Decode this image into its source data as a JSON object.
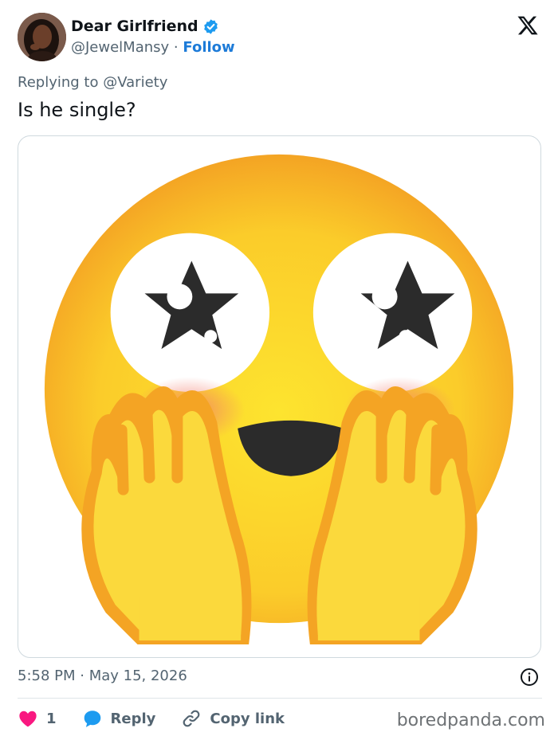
{
  "author": {
    "display_name": "Dear Girlfriend",
    "handle": "@JewelMansy",
    "separator": "·",
    "follow_label": "Follow"
  },
  "replying_to": {
    "prefix": "Replying to",
    "mention": "@Variety"
  },
  "tweet_text": "Is he single?",
  "media_alt_icon": "star-struck-hands-on-cheeks-emoji",
  "timestamp": "5:58 PM · May 15, 2026",
  "actions": {
    "like_count": "1",
    "reply_label": "Reply",
    "copy_link_label": "Copy link"
  },
  "watermark": "boredpanda.com",
  "colors": {
    "like": "#f91880",
    "reply": "#1d9bf0",
    "follow": "#1d7bd8",
    "verified": "#1d9bf0",
    "secondary_text": "#536471"
  }
}
